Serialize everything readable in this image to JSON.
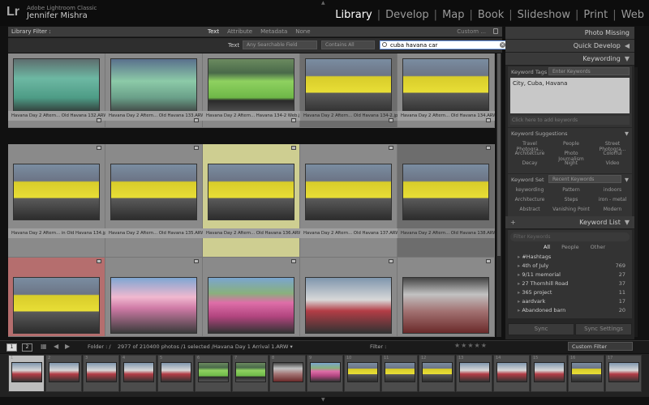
{
  "header": {
    "logo": "Lr",
    "app_name": "Adobe Lightroom Classic",
    "user_name": "Jennifer Mishra",
    "modules": [
      "Library",
      "Develop",
      "Map",
      "Book",
      "Slideshow",
      "Print",
      "Web"
    ],
    "active_module": "Library"
  },
  "filter_bar": {
    "label": "Library Filter :",
    "tabs": [
      "Text",
      "Attribute",
      "Metadata",
      "None"
    ],
    "active_tab": "Text",
    "preset": "Custom ..."
  },
  "text_filter": {
    "label": "Text",
    "field": "Any Searchable Field",
    "rule": "Contains All",
    "query": "cuba havana car"
  },
  "grid": {
    "rows": [
      {
        "cells": [
          {
            "caption": "Havana Day 2 Aftern... Old Havana 132.ARW",
            "thumb": "car-teal",
            "style": "",
            "num": ""
          },
          {
            "caption": "Havana Day 2 Aftern... Old Havana 133.ARW",
            "thumb": "car-mint",
            "style": "",
            "num": ""
          },
          {
            "caption": "Havana Day 2 Aftern... Havana 134-2 Web.jpg",
            "thumb": "car-green",
            "style": "",
            "num": ""
          },
          {
            "caption": "Havana Day 2 Aftern... Old Havana 134-2.jpg",
            "thumb": "car-yellow",
            "style": "dark",
            "num": ""
          },
          {
            "caption": "Havana Day 2 Aftern... Old Havana 134.ARW",
            "thumb": "car-yellow",
            "style": "",
            "num": ""
          }
        ]
      },
      {
        "cells": [
          {
            "caption": "Havana Day 2 Aftern... in Old Havana 134.jpg",
            "thumb": "car-yellow",
            "style": "",
            "num": ""
          },
          {
            "caption": "Havana Day 2 Aftern... Old Havana 135.ARW",
            "thumb": "car-yellow",
            "style": "",
            "num": ""
          },
          {
            "caption": "Havana Day 2 Aftern... Old Havana 136.ARW",
            "thumb": "car-yellow",
            "style": "hl",
            "num": ""
          },
          {
            "caption": "Havana Day 2 Aftern... Old Havana 137.ARW",
            "thumb": "car-yellow",
            "style": "",
            "num": ""
          },
          {
            "caption": "Havana Day 2 Aftern... Old Havana 138.ARW",
            "thumb": "car-yellow",
            "style": "dark",
            "num": ""
          }
        ]
      },
      {
        "cells": [
          {
            "caption": "",
            "thumb": "car-yellow",
            "style": "rd",
            "num": ""
          },
          {
            "caption": "",
            "thumb": "car-pinkrow",
            "style": "",
            "num": ""
          },
          {
            "caption": "",
            "thumb": "car-pink",
            "style": "",
            "num": ""
          },
          {
            "caption": "",
            "thumb": "car-white",
            "style": "",
            "num": ""
          },
          {
            "caption": "",
            "thumb": "car-interior",
            "style": "",
            "num": ""
          }
        ]
      }
    ]
  },
  "right_panel": {
    "sections": {
      "photo_missing": "Photo Missing",
      "quick_develop": "Quick Develop",
      "keywording": "Keywording",
      "keyword_list": "Keyword List"
    },
    "keyword_tags": {
      "label": "Keyword Tags",
      "mode": "Enter Keywords",
      "value": "City, Cuba, Havana",
      "placeholder": "Click here to add keywords"
    },
    "suggestions": {
      "label": "Keyword Suggestions",
      "items": [
        "Travel Photogra...",
        "People",
        "Street Photogra...",
        "Architecture",
        "Photo Journalism",
        "Colorful",
        "Decay",
        "Night",
        "Video"
      ]
    },
    "keyword_set": {
      "label": "Keyword Set",
      "value": "Recent Keywords",
      "items": [
        "keywording",
        "Pattern",
        "indoors",
        "Architecture",
        "Steps",
        "iron - metal",
        "Abstract",
        "Vanishing Point",
        "Modern"
      ]
    },
    "keyword_list": {
      "filter_placeholder": "Filter Keywords",
      "tabs": [
        "All",
        "People",
        "Other"
      ],
      "active_tab": "All",
      "items": [
        {
          "name": "#Hashtags",
          "count": ""
        },
        {
          "name": "4th of July",
          "count": "769"
        },
        {
          "name": "9/11 memorial",
          "count": "27"
        },
        {
          "name": "27 Thornhill Road",
          "count": "37"
        },
        {
          "name": "365 project",
          "count": "11"
        },
        {
          "name": "aardvark",
          "count": "17"
        },
        {
          "name": "Abandoned barn",
          "count": "20"
        }
      ]
    },
    "sync": "Sync",
    "sync_settings": "Sync Settings"
  },
  "toolbar": {
    "page1": "1",
    "page2": "2",
    "folder": "Folder : /",
    "count": "2977 of 210400 photos /1 selected /Havana Day 1 Arrival 1.ARW",
    "filter_label": "Filter :",
    "custom_filter": "Custom Filter"
  },
  "filmstrip": {
    "numbers": [
      "1",
      "2",
      "3",
      "4",
      "5",
      "6",
      "7",
      "8",
      "9",
      "10",
      "11",
      "12",
      "13",
      "14",
      "15",
      "16",
      "17"
    ],
    "thumbs": [
      "car-white",
      "car-white",
      "car-white",
      "car-white",
      "car-white",
      "car-green",
      "car-green",
      "car-interior",
      "car-pink",
      "car-yellow",
      "car-yellow",
      "car-yellow",
      "car-white",
      "car-white",
      "car-white",
      "car-yellow",
      "car-white"
    ]
  }
}
